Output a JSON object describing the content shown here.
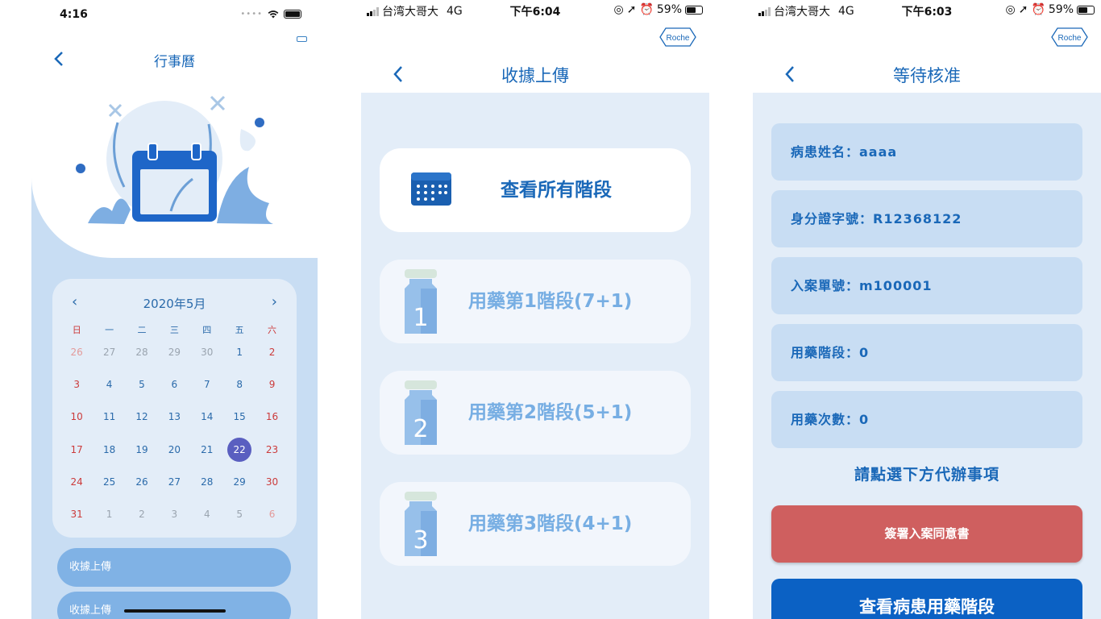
{
  "screen1": {
    "status_time": "4:16",
    "title": "行事曆",
    "calendar": {
      "month_label": "2020年5月",
      "weekdays": [
        "日",
        "一",
        "二",
        "三",
        "四",
        "五",
        "六"
      ],
      "weeks": [
        [
          "26",
          "27",
          "28",
          "29",
          "30",
          "1",
          "2"
        ],
        [
          "3",
          "4",
          "5",
          "6",
          "7",
          "8",
          "9"
        ],
        [
          "10",
          "11",
          "12",
          "13",
          "14",
          "15",
          "16"
        ],
        [
          "17",
          "18",
          "19",
          "20",
          "21",
          "22",
          "23"
        ],
        [
          "24",
          "25",
          "26",
          "27",
          "28",
          "29",
          "30"
        ],
        [
          "31",
          "1",
          "2",
          "3",
          "4",
          "5",
          "6"
        ]
      ],
      "selected_day": "22"
    },
    "pills": [
      "收據上傳",
      "收據上傳"
    ]
  },
  "screen2": {
    "status": {
      "carrier": "台湾大哥大",
      "network": "4G",
      "time": "下午6:04",
      "battery": "59%"
    },
    "logo": "Roche",
    "title": "收據上傳",
    "cards": [
      {
        "label": "查看所有階段",
        "icon": "calendar-icon"
      },
      {
        "label": "用藥第1階段(7+1)",
        "num": "1",
        "icon": "vial-icon"
      },
      {
        "label": "用藥第2階段(5+1)",
        "num": "2",
        "icon": "vial-icon"
      },
      {
        "label": "用藥第3階段(4+1)",
        "num": "3",
        "icon": "vial-icon"
      }
    ]
  },
  "screen3": {
    "status": {
      "carrier": "台湾大哥大",
      "network": "4G",
      "time": "下午6:03",
      "battery": "59%"
    },
    "logo": "Roche",
    "title": "等待核准",
    "info": [
      "病患姓名：aaaa",
      "身分證字號：R12368122",
      "入案單號：m100001",
      "用藥階段：0",
      "用藥次數：0"
    ],
    "hint": "請點選下方代辦事項",
    "sign_button": "簽署入案同意書",
    "view_button": "查看病患用藥階段"
  },
  "colors": {
    "primary": "#1a68b8",
    "panel": "#e3edf8",
    "card": "#c8ddf3",
    "danger": "#cf5f5f",
    "button": "#0b61c4",
    "selected": "#5a5fc0"
  }
}
